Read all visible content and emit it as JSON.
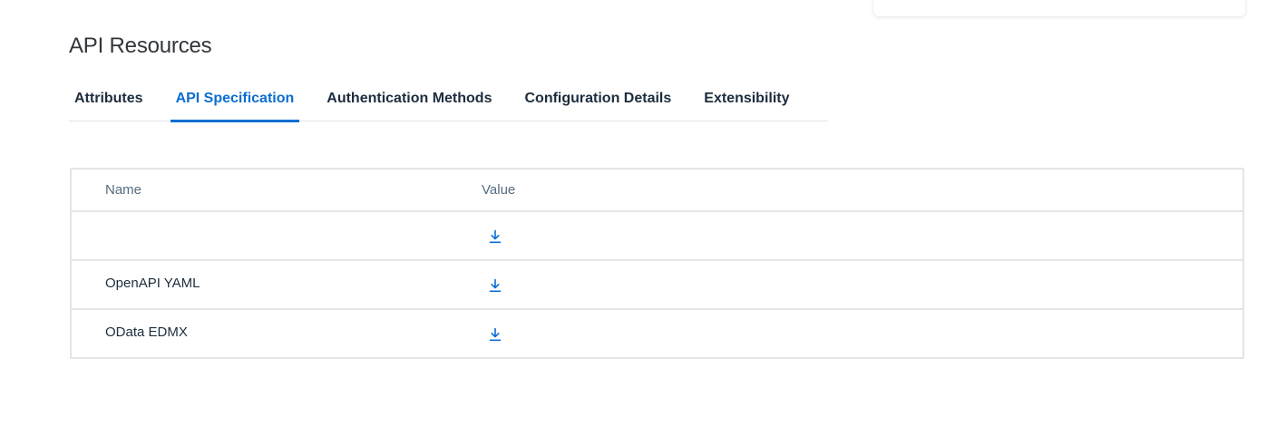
{
  "section": {
    "title": "API Resources"
  },
  "tabs": [
    {
      "label": "Attributes",
      "active": false
    },
    {
      "label": "API Specification",
      "active": true
    },
    {
      "label": "Authentication Methods",
      "active": false
    },
    {
      "label": "Configuration Details",
      "active": false
    },
    {
      "label": "Extensibility",
      "active": false
    }
  ],
  "table": {
    "columns": {
      "name": "Name",
      "value": "Value"
    },
    "rows": [
      {
        "name": "",
        "value_icon": "download-icon"
      },
      {
        "name": "OpenAPI YAML",
        "value_icon": "download-icon"
      },
      {
        "name": "OData EDMX",
        "value_icon": "download-icon"
      }
    ]
  },
  "colors": {
    "accent": "#0a6ed1",
    "text": "#1d2d3e",
    "header_text": "#556b82",
    "border": "#e5e5e5"
  }
}
